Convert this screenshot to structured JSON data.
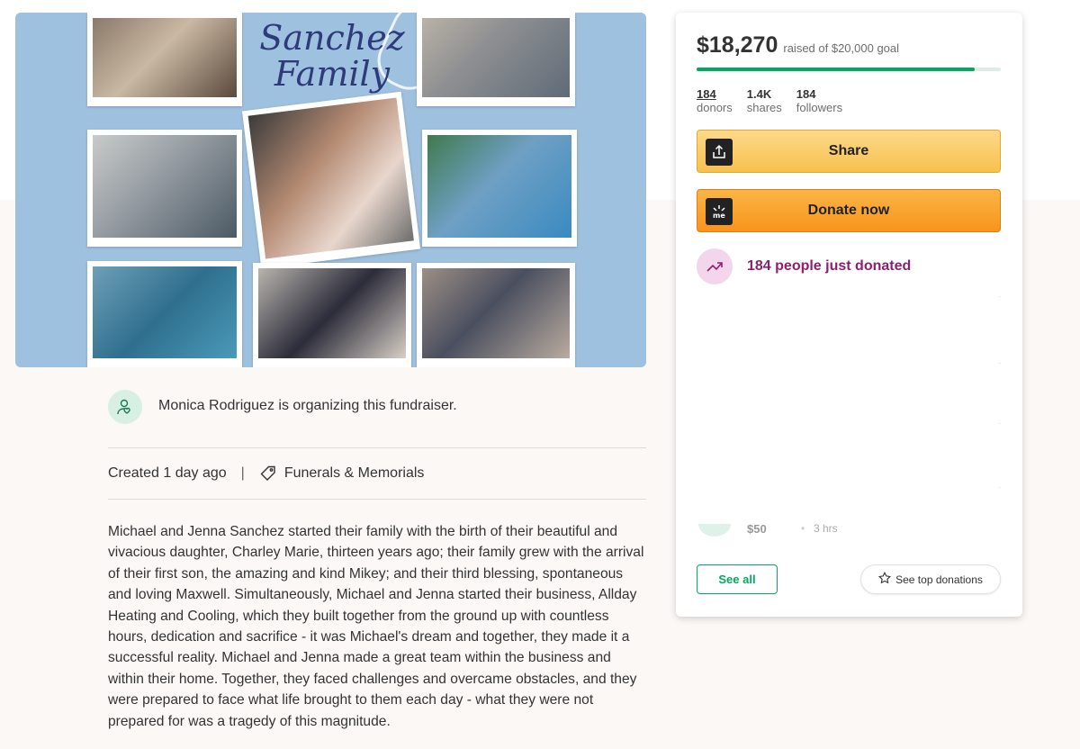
{
  "hero": {
    "collage_title_line1": "Sanchez",
    "collage_title_line2": "Family"
  },
  "organizer": {
    "text": "Monica Rodriguez is organizing this fundraiser.",
    "icon": "person-heart-icon"
  },
  "meta": {
    "created": "Created 1 day ago",
    "separator": "|",
    "category": "Funerals & Memorials",
    "category_icon": "tag-icon"
  },
  "story": {
    "text": "Michael and Jenna Sanchez started their family with the birth of their beautiful and vivacious daughter, Charley Marie, thirteen years ago; their family grew with the arrival of their first son, the amazing and kind Mikey; and their third blessing, spontaneous and loving Maxwell.  Simultaneously, Michael and Jenna started their business, Allday Heating and Cooling, which they built together from the ground up with countless hours, dedication and sacrifice - it was Michael's dream and together, they made it a successful reality.  Michael and Jenna made a great team within the business and within their home.  Together, they faced challenges and overcame obstacles, and they were prepared to face what life brought to them each day - what they were not prepared for was a tragedy of this magnitude."
  },
  "card": {
    "amount": "$18,270",
    "goal_text": "raised of $20,000 goal",
    "progress_fraction": 0.9135,
    "stats": [
      {
        "value": "184",
        "label": "donors"
      },
      {
        "value": "1.4K",
        "label": "shares"
      },
      {
        "value": "184",
        "label": "followers"
      }
    ],
    "share_label": "Share",
    "share_icon": "share-upload-icon",
    "donate_label": "Donate now",
    "donate_icon": "gofundme-logo-icon",
    "trending_text": "184 people just donated",
    "trending_icon": "trending-up-icon",
    "partial_donation_amount": "$50",
    "partial_donation_dot": "•",
    "partial_donation_time": "3 hrs",
    "see_all_label": "See all",
    "top_donations_label": "See top donations",
    "top_donations_icon": "star-icon"
  },
  "colors": {
    "brand_green": "#02a95c",
    "share_yellow": "#f7c14f",
    "donate_orange": "#f7941d",
    "trending_purple": "#8c1f72"
  }
}
